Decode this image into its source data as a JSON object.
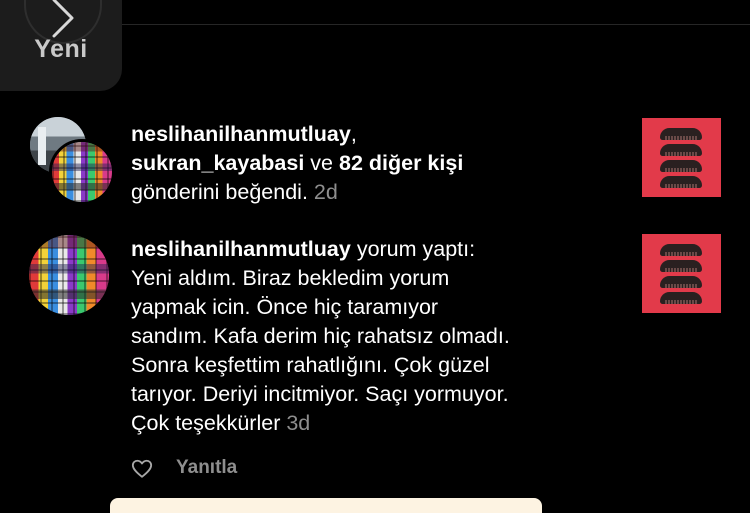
{
  "header": {
    "new_label": "Yeni"
  },
  "notifications": [
    {
      "users": [
        "neslihanilhanmutluay",
        "sukran_kayabasi"
      ],
      "connector": "ve",
      "others": "82 diğer kişi",
      "action": "gönderini beğendi.",
      "time": "2d"
    },
    {
      "user": "neslihanilhanmutluay",
      "action": "yorum yaptı:",
      "comment_lines": [
        "Yeni aldım. Biraz bekledim yorum",
        "yapmak icin.  Önce hiç taramıyor",
        "sandım.  Kafa derim hiç rahatsız olmadı.",
        "Sonra keşfettim rahatlığını.  Çok güzel",
        "tarıyor. Deriyi incitmiyor. Saçı yormuyor.",
        "Çok teşekkürler"
      ],
      "time": "3d",
      "reply_label": "Yanıtla"
    }
  ],
  "colors": {
    "background": "#000000",
    "secondary_text": "#8e8e8e",
    "thumbnail_red": "#e23a4a"
  },
  "icons": {
    "new_pill": "chevron-right-icon",
    "like": "heart-outline-icon"
  }
}
